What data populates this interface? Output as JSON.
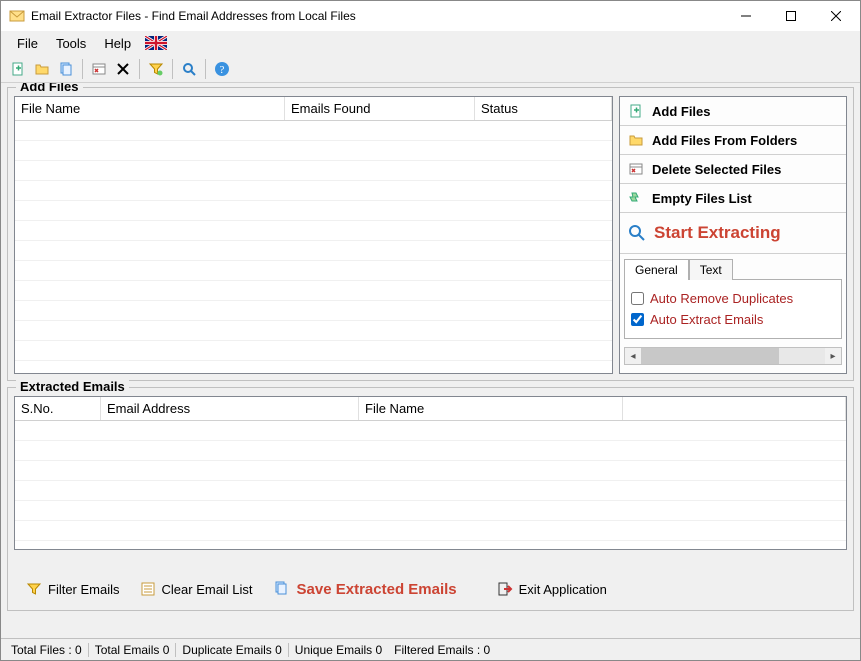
{
  "window": {
    "title": "Email Extractor Files -  Find Email Addresses from Local Files"
  },
  "menu": {
    "file": "File",
    "tools": "Tools",
    "help": "Help"
  },
  "sections": {
    "add_files": "Add Files",
    "extracted_emails": "Extracted Emails"
  },
  "columns": {
    "file_name": "File Name",
    "emails_found": "Emails Found",
    "status": "Status",
    "sno": "S.No.",
    "email_address": "Email Address",
    "file_name2": "File Name"
  },
  "side": {
    "add_files": "Add Files",
    "add_folders": "Add Files From Folders",
    "delete_selected": "Delete Selected Files",
    "empty_list": "Empty Files List",
    "start": "Start Extracting"
  },
  "tabs": {
    "general": "General",
    "text": "Text"
  },
  "options": {
    "auto_remove": "Auto Remove Duplicates",
    "auto_extract": "Auto Extract Emails"
  },
  "bottom": {
    "filter": "Filter Emails",
    "clear": "Clear Email List",
    "save": "Save Extracted Emails",
    "exit": "Exit Application"
  },
  "status": {
    "total_files": "Total Files :  0",
    "total_emails": "Total Emails   0",
    "duplicate_emails": "Duplicate Emails   0",
    "unique_emails": "Unique Emails   0",
    "filtered_emails": "Filtered Emails :   0"
  }
}
